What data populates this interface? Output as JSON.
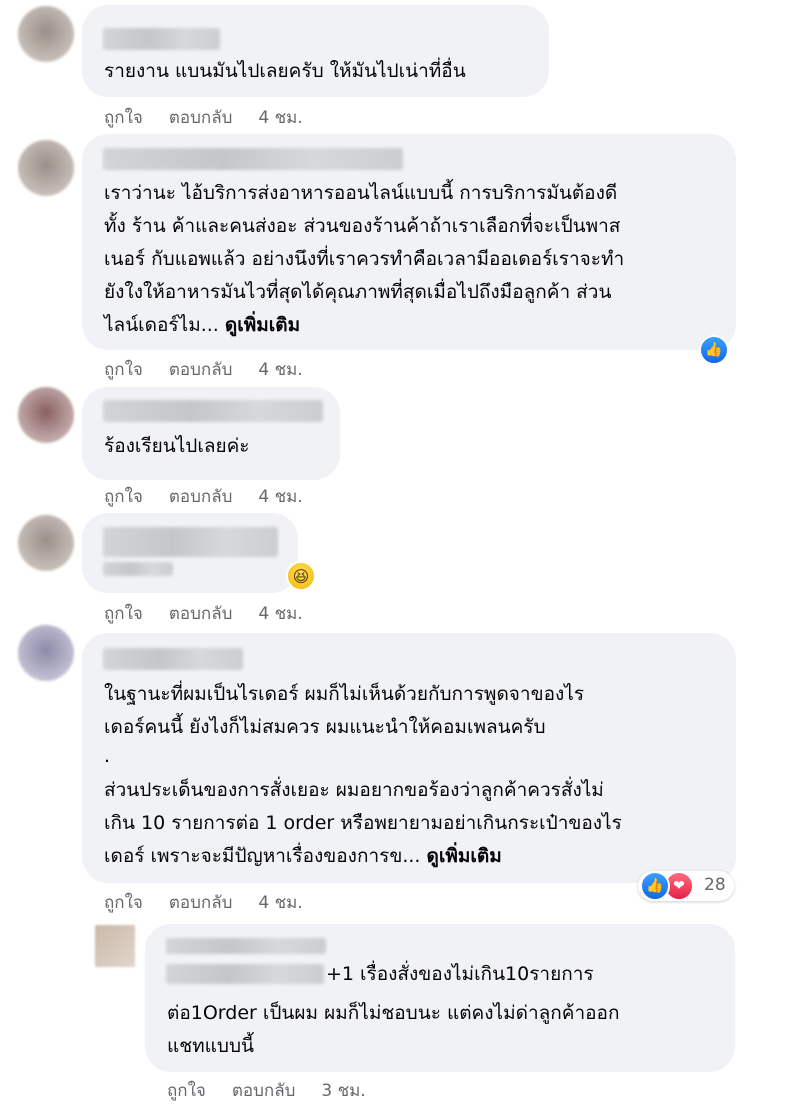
{
  "comments": [
    {
      "lines": [
        "รายงาน แบนมันไปเลยครับ ให้มันไปเน่าที่อื่น"
      ],
      "like_label": "ถูกใจ",
      "reply_label": "ตอบกลับ",
      "time": "4 ชม."
    },
    {
      "lines": [
        "เราว่านะ ไอ้บริการส่งอาหารออนไลน์แบบนี้ การบริการมันต้องดี",
        "ทั้ง ร้าน ค้าและคนส่งอะ ส่วนของร้านค้าถ้าเราเลือกที่จะเป็นพาส",
        "เนอร์ กับแอพแล้ว อย่างนึงที่เราควรทำคือเวลามีออเดอร์เราจะทำ",
        "ยังใงให้อาหารมันไวที่สุดได้คุณภาพที่สุดเมื่อไปถึงมือลูกค้า ส่วน",
        "ไลน์เดอร์ไม..."
      ],
      "see_more": "ดูเพิ่มเติม",
      "reaction_icon": "like-icon",
      "like_label": "ถูกใจ",
      "reply_label": "ตอบกลับ",
      "time": "4 ชม."
    },
    {
      "lines": [
        "ร้องเรียนไปเลยค่ะ"
      ],
      "like_label": "ถูกใจ",
      "reply_label": "ตอบกลับ",
      "time": "4 ชม."
    },
    {
      "lines": [
        ""
      ],
      "reaction_icon": "haha-icon",
      "like_label": "ถูกใจ",
      "reply_label": "ตอบกลับ",
      "time": "4 ชม."
    },
    {
      "lines": [
        "ในฐานะที่ผมเป็นไรเดอร์ ผมก็ไม่เห็นด้วยกับการพูดจาของไร",
        "เดอร์คนนี้ ยังไงก็ไม่สมควร ผมแนะนำให้คอมเพลนครับ",
        ".",
        "ส่วนประเด็นของการสั่งเยอะ ผมอยากขอร้องว่าลูกค้าควรสั่งไม่",
        "เกิน 10 รายการต่อ 1 order หรือพยายามอย่าเกินกระเป๋าของไร",
        "เดอร์ เพราะจะมีปัญหาเรื่องของการข..."
      ],
      "see_more": "ดูเพิ่มเติม",
      "reaction_count": "28",
      "like_label": "ถูกใจ",
      "reply_label": "ตอบกลับ",
      "time": "4 ชม."
    },
    {
      "lines": [
        "+1 เรื่องสั่งของไม่เกิน10รายการ",
        "ต่อ1Order เป็นผม ผมก็ไม่ชอบนะ แต่คงไม่ด่าลูกค้าออก",
        "แชทแบบนี้"
      ],
      "like_label": "ถูกใจ",
      "reply_label": "ตอบกลับ",
      "time": "3 ชม."
    }
  ]
}
